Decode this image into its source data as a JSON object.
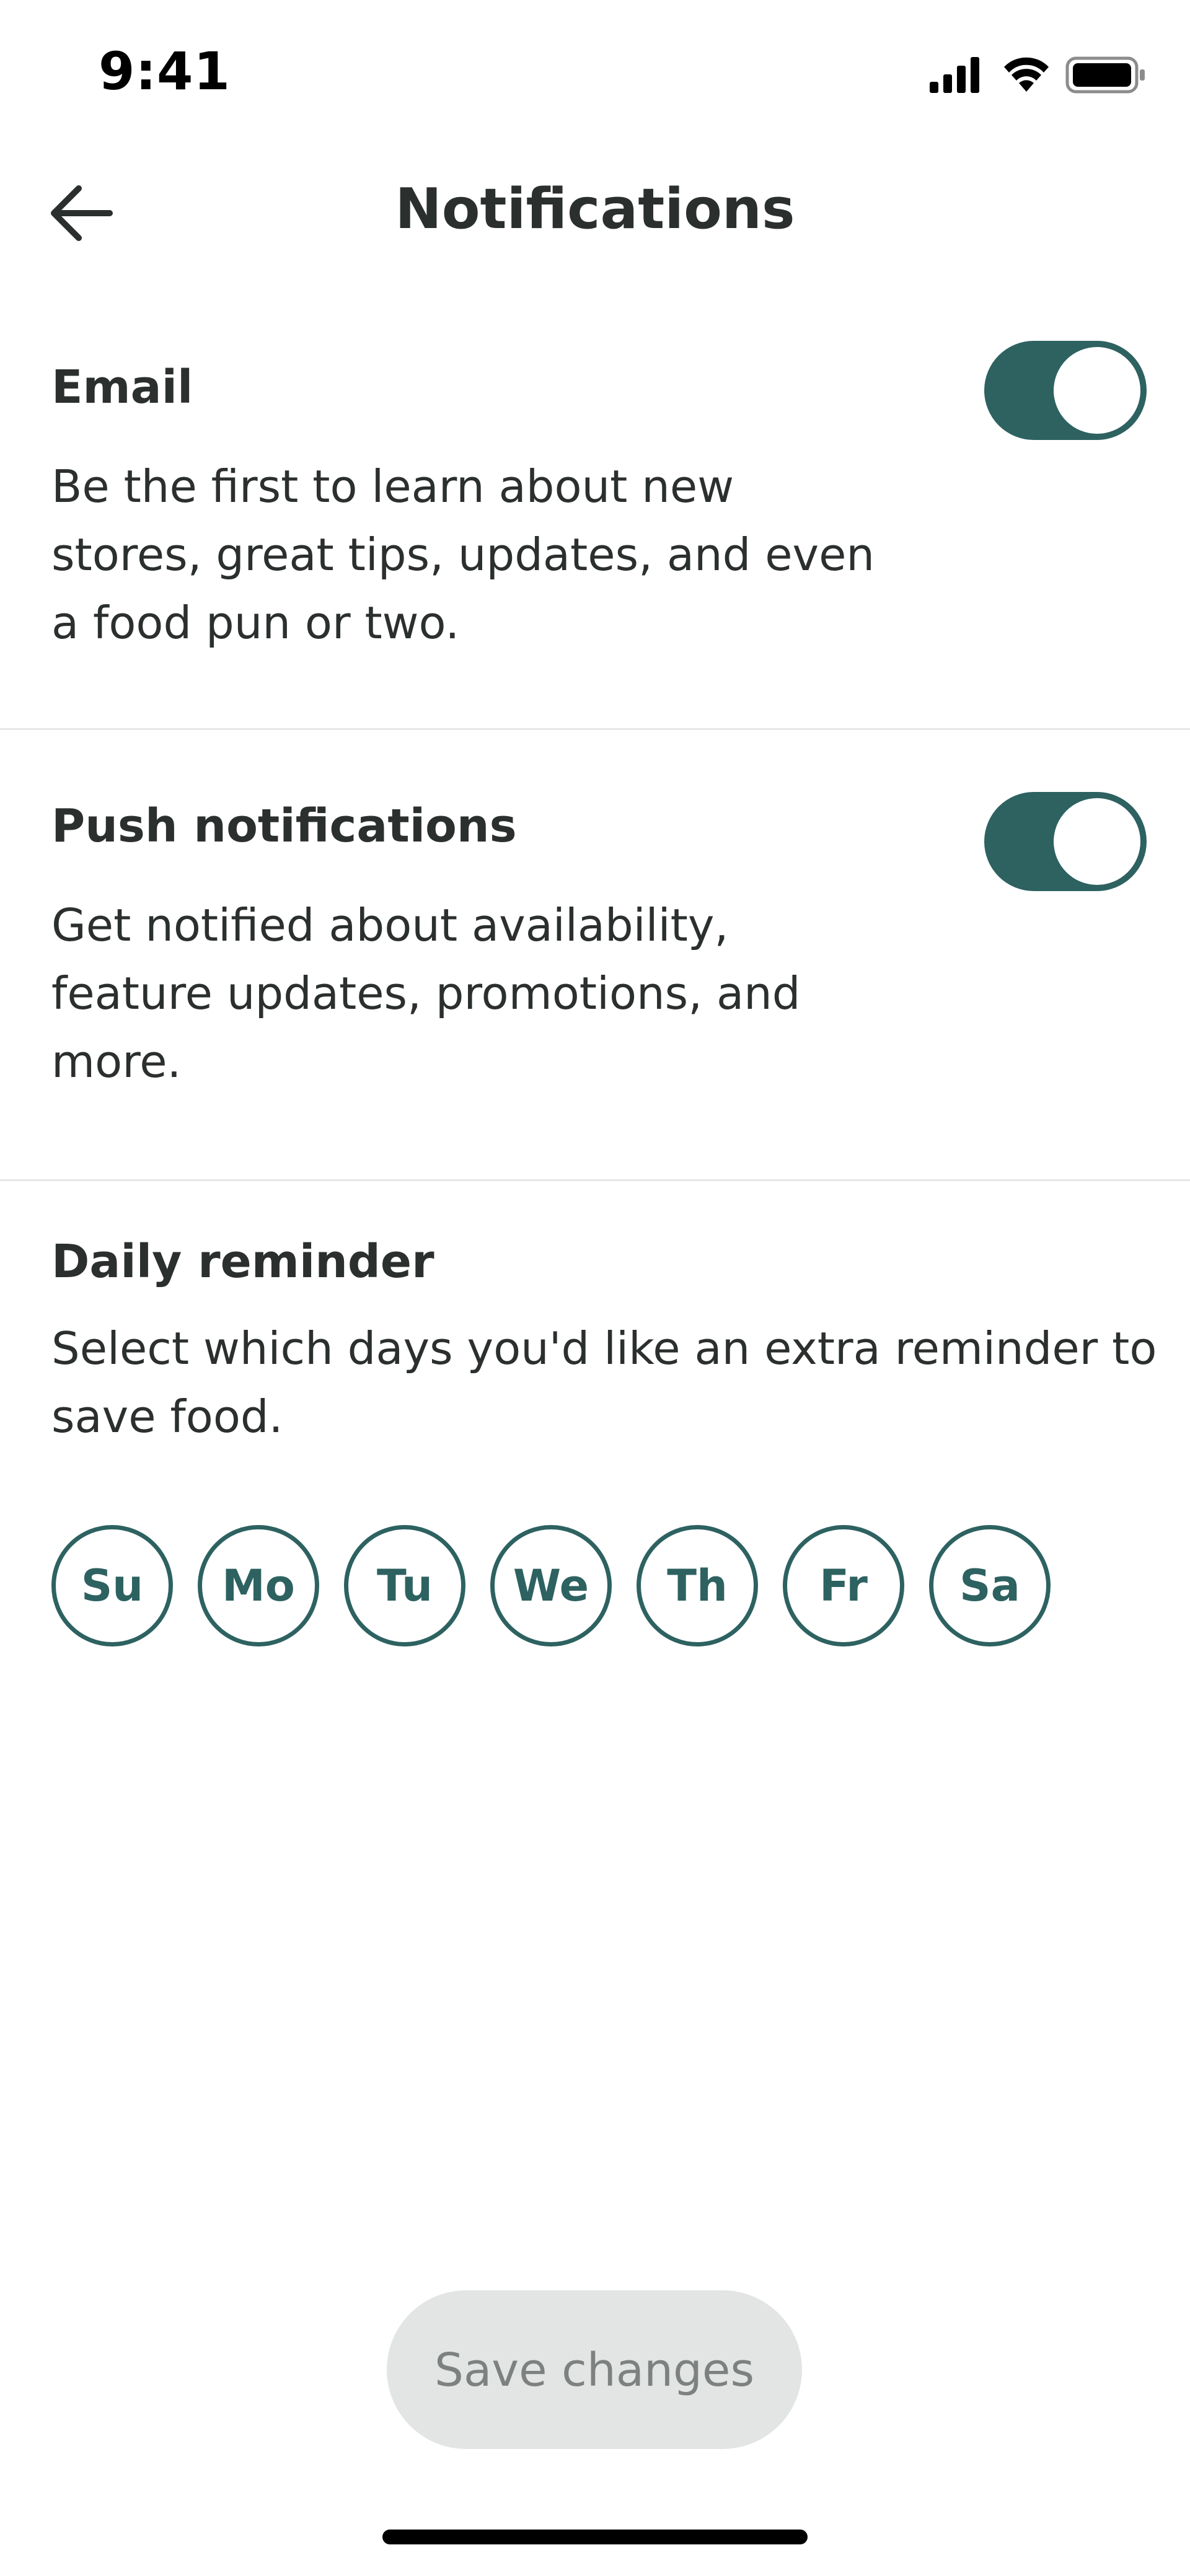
{
  "status_bar": {
    "time": "9:41",
    "icons": [
      "cellular-signal-icon",
      "wifi-icon",
      "battery-icon"
    ]
  },
  "header": {
    "title": "Notifications",
    "back_icon": "arrow-left-icon"
  },
  "email": {
    "title": "Email",
    "description": "Be the first to learn about new\nstores, great tips, updates, and even\na food pun or two.",
    "enabled": true
  },
  "push": {
    "title": "Push notifications",
    "description": "Get notified about availability,\nfeature updates, promotions, and\nmore.",
    "enabled": true
  },
  "daily": {
    "title": "Daily reminder",
    "description": "Select which days you'd like an extra reminder to\nsave food.",
    "days": [
      "Su",
      "Mo",
      "Tu",
      "We",
      "Th",
      "Fr",
      "Sa"
    ]
  },
  "footer": {
    "save_label": "Save changes"
  },
  "colors": {
    "accent": "#2d6261",
    "text": "#2b2f2e",
    "disabled_bg": "#e2e5e4",
    "disabled_text": "#7d8280",
    "divider": "#e6e8e7"
  }
}
